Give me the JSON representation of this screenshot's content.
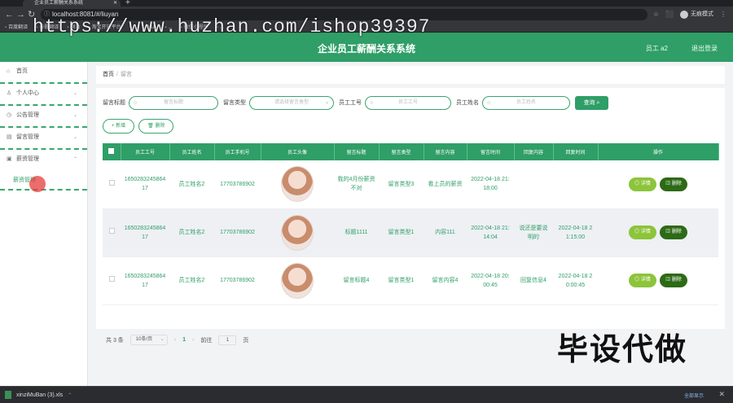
{
  "browser": {
    "tab_title": "企业员工薪酬关系系统",
    "url": "localhost:8081/#/liuyan",
    "profile_label": "无痕模式",
    "bookmarks": [
      "百度翻译",
      "谷歌翻译",
      "网站",
      "淘宝开放平台",
      "...",
      "Vue",
      "...",
      "微信小程序",
      "..."
    ]
  },
  "watermark": "https://www.huzhan.com/ishop39397",
  "header": {
    "title": "企业员工薪酬关系系统",
    "user": "员工 a2",
    "logout": "退出登录"
  },
  "sidebar": {
    "items": [
      {
        "label": "首页",
        "icon": "home-icon"
      },
      {
        "label": "个人中心",
        "icon": "user-icon"
      },
      {
        "label": "公告管理",
        "icon": "notice-icon"
      },
      {
        "label": "留言管理",
        "icon": "message-icon"
      },
      {
        "label": "薪资管理",
        "icon": "salary-icon"
      }
    ],
    "active_sub": "薪资管理"
  },
  "breadcrumb": {
    "home": "首页",
    "current": "留言"
  },
  "search": {
    "fields": [
      {
        "label": "留言标题",
        "placeholder": "留言标题"
      },
      {
        "label": "留言类型",
        "placeholder": "请选择留言类型"
      },
      {
        "label": "员工工号",
        "placeholder": "员工工号"
      },
      {
        "label": "员工姓名",
        "placeholder": "员工姓名"
      }
    ],
    "button": "查询"
  },
  "actions": {
    "add": "+ 新增",
    "delete": "删除"
  },
  "table": {
    "headers": [
      "员工工号",
      "员工姓名",
      "员工手机号",
      "员工头像",
      "留言标题",
      "留言类型",
      "留言内容",
      "留言时间",
      "回复内容",
      "回复时间",
      "操作"
    ],
    "rows": [
      {
        "id": "165028324586417",
        "name": "员工姓名2",
        "phone": "17703786902",
        "title": "我的4月份薪资不对",
        "type": "留言类型3",
        "content": "看上员的薪资",
        "time": "2022-04-18 21:18:00",
        "reply": "",
        "reply_time": ""
      },
      {
        "id": "165028324586417",
        "name": "员工姓名2",
        "phone": "17703786902",
        "title": "标题1111",
        "type": "留言类型1",
        "content": "内容111",
        "time": "2022-04-18 21:14:04",
        "reply": "说还是要说明的",
        "reply_time": "2022-04-18 21:15:00"
      },
      {
        "id": "165028324586417",
        "name": "员工姓名2",
        "phone": "17703786902",
        "title": "留言标题4",
        "type": "留言类型1",
        "content": "留言内容4",
        "time": "2022-04-18 20:00:45",
        "reply": "回复信息4",
        "reply_time": "2022-04-18 20:00:45"
      }
    ],
    "op_detail": "详情",
    "op_delete": "删除"
  },
  "pager": {
    "total": "共 3 条",
    "page_size": "10条/页",
    "current": "1",
    "goto_label": "前往",
    "goto_value": "1",
    "page_unit": "页"
  },
  "overlay_text": "毕设代做",
  "downloads": {
    "file": "xinziMuBan (3).xls",
    "show_all": "全部显示"
  }
}
